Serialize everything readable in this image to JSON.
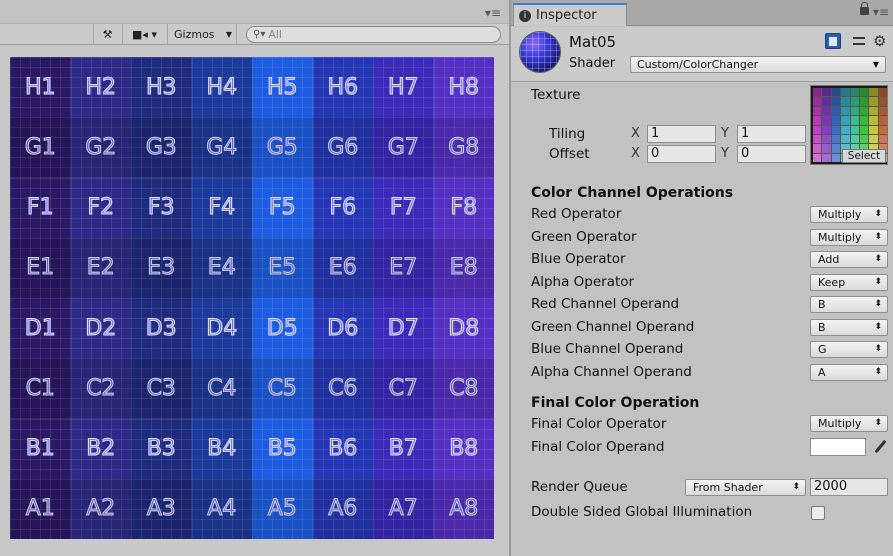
{
  "scene": {
    "toolbar": {
      "gizmos_label": "Gizmos",
      "search_placeholder": "All",
      "tools_icon": "tools-icon",
      "camera_icon": "camera-icon"
    },
    "grid": {
      "rows": [
        [
          "H1",
          "H2",
          "H3",
          "H4",
          "H5",
          "H6",
          "H7",
          "H8"
        ],
        [
          "G1",
          "G2",
          "G3",
          "G4",
          "G5",
          "G6",
          "G7",
          "G8"
        ],
        [
          "F1",
          "F2",
          "F3",
          "F4",
          "F5",
          "F6",
          "F7",
          "F8"
        ],
        [
          "E1",
          "E2",
          "E3",
          "E4",
          "E5",
          "E6",
          "E7",
          "E8"
        ],
        [
          "D1",
          "D2",
          "D3",
          "D4",
          "D5",
          "D6",
          "D7",
          "D8"
        ],
        [
          "C1",
          "C2",
          "C3",
          "C4",
          "C5",
          "C6",
          "C7",
          "C8"
        ],
        [
          "B1",
          "B2",
          "B3",
          "B4",
          "B5",
          "B6",
          "B7",
          "B8"
        ],
        [
          "A1",
          "A2",
          "A3",
          "A4",
          "A5",
          "A6",
          "A7",
          "A8"
        ]
      ]
    }
  },
  "inspector": {
    "tab_label": "Inspector",
    "material": {
      "name": "Mat05",
      "shader_label": "Shader",
      "shader_value": "Custom/ColorChanger"
    },
    "texture": {
      "label": "Texture",
      "select_label": "Select",
      "tiling_label": "Tiling",
      "offset_label": "Offset",
      "x_label": "X",
      "y_label": "Y",
      "tiling_x": "1",
      "tiling_y": "1",
      "offset_x": "0",
      "offset_y": "0"
    },
    "color_channel": {
      "heading": "Color Channel Operations",
      "rows": [
        {
          "label": "Red Operator",
          "value": "Multiply"
        },
        {
          "label": "Green Operator",
          "value": "Multiply"
        },
        {
          "label": "Blue Operator",
          "value": "Add"
        },
        {
          "label": "Alpha Operator",
          "value": "Keep"
        },
        {
          "label": "Red Channel Operand",
          "value": "B"
        },
        {
          "label": "Green Channel Operand",
          "value": "B"
        },
        {
          "label": "Blue Channel Operand",
          "value": "G"
        },
        {
          "label": "Alpha Channel Operand",
          "value": "A"
        }
      ]
    },
    "final_color": {
      "heading": "Final Color Operation",
      "operator_label": "Final Color Operator",
      "operator_value": "Multiply",
      "operand_label": "Final Color Operand",
      "operand_color": "#ffffff"
    },
    "render_queue": {
      "label": "Render Queue",
      "mode": "From Shader",
      "value": "2000"
    },
    "gi": {
      "label": "Double Sided Global Illumination",
      "checked": false
    }
  }
}
